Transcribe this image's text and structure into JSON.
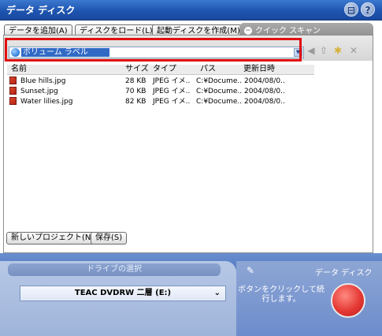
{
  "window": {
    "title": "データ ディスク",
    "help_icon": "help-icon",
    "disk_icon": "disk-icon"
  },
  "toolbar": {
    "add_data_label": "データを追加(A)",
    "load_disk_label": "ディスクをロード(L)",
    "create_boot_label": "起動ディスクを作成(M)",
    "quick_scan_label": "クイック スキャン"
  },
  "address": {
    "value": "ボリューム ラベル",
    "icon": "globe-icon"
  },
  "nav_icons": [
    "back-icon",
    "up-folder-icon",
    "new-folder-icon",
    "delete-icon"
  ],
  "columns": [
    "名前",
    "サイズ",
    "タイプ",
    "パス",
    "更新日時"
  ],
  "files": [
    {
      "name": "Blue hills.jpg",
      "size": "28 KB",
      "type": "JPEG イメ..",
      "path": "C:¥Docume..",
      "date": "2004/08/0.."
    },
    {
      "name": "Sunset.jpg",
      "size": "70 KB",
      "type": "JPEG イメ..",
      "path": "C:¥Docume..",
      "date": "2004/08/0.."
    },
    {
      "name": "Water lilies.jpg",
      "size": "82 KB",
      "type": "JPEG イメ..",
      "path": "C:¥Docume..",
      "date": "2004/08/0.."
    }
  ],
  "panel_buttons": {
    "new_project_label": "新しいプロジェクト(N)",
    "save_label": "保存(S)"
  },
  "drive": {
    "section_label": "ドライブの選択",
    "selected": "TEAC DVDRW 二層 (E:)"
  },
  "action": {
    "title": "データ ディスク",
    "instruction": "ボタンをクリックして続行します。"
  },
  "colors": {
    "title_bar": "#1e55b0",
    "highlight": "#e01010",
    "go_button": "#e53935"
  }
}
